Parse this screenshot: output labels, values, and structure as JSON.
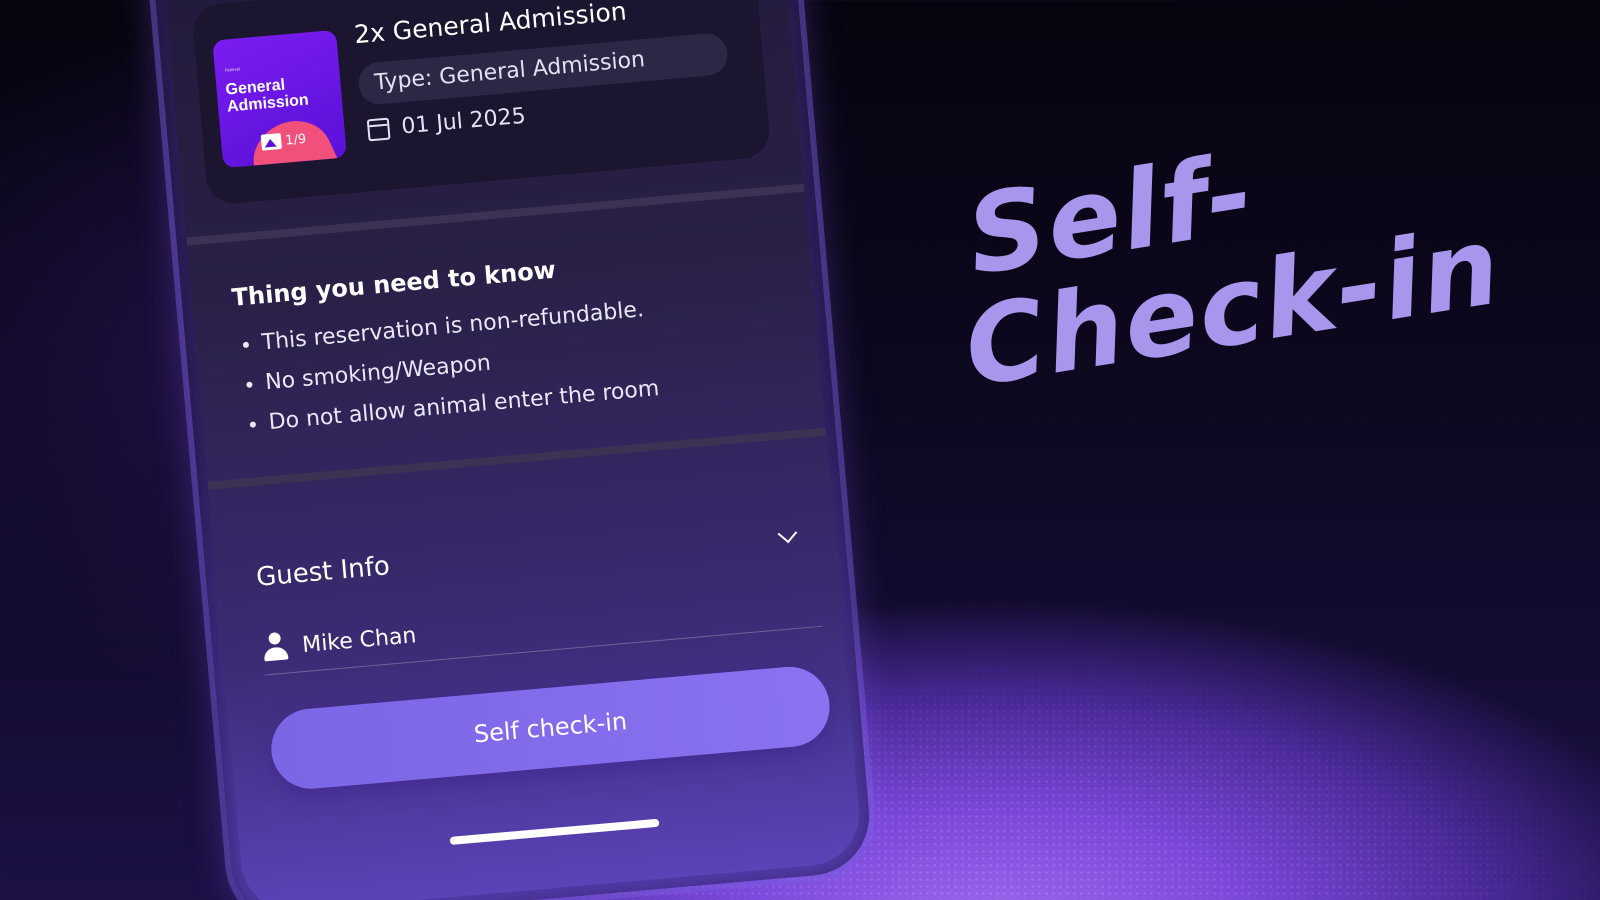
{
  "headline": {
    "line1": "Self-",
    "line2": "Check-in"
  },
  "ticket": {
    "thumb_tiny": "Festival",
    "thumb_title": "General Admission",
    "thumb_counter": "1/9",
    "title": "2x General Admission",
    "type": "Type: General Admission",
    "date": "01 Jul 2025"
  },
  "notes": {
    "title": "Thing you need to know",
    "items": [
      "This reservation is non-refundable.",
      "No smoking/Weapon",
      "Do not allow animal enter the room"
    ]
  },
  "guest": {
    "title": "Guest Info",
    "name": "Mike Chan"
  },
  "action": {
    "label": "Self check-in"
  },
  "colors": {
    "accent": "#8a72f0",
    "headline": "#a896ec"
  },
  "icons": [
    "image-icon",
    "calendar-icon",
    "chevron-down-icon",
    "person-icon"
  ]
}
